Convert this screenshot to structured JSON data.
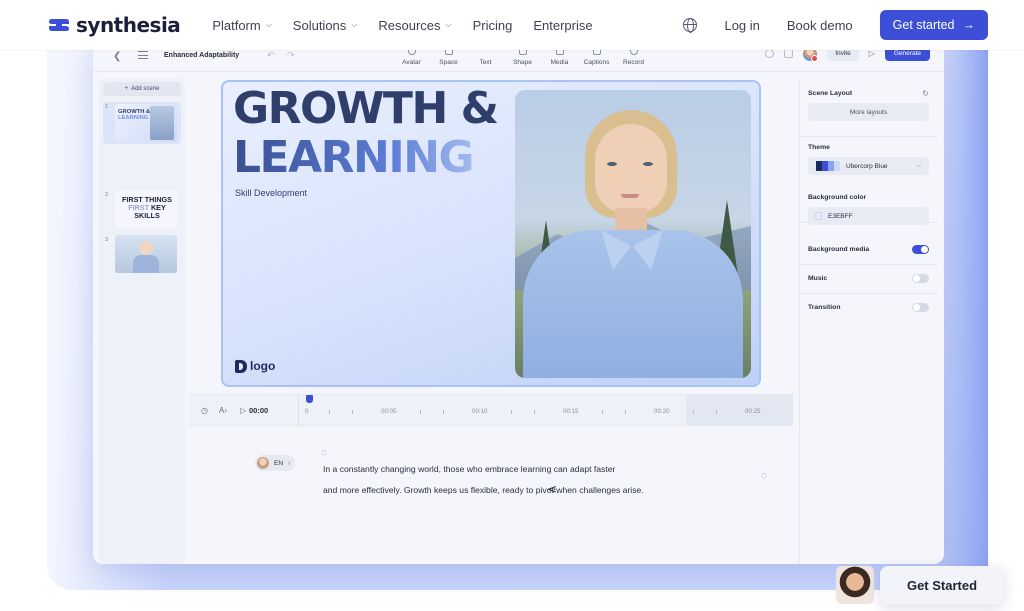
{
  "site": {
    "brand": "synthesia",
    "nav": [
      {
        "label": "Platform",
        "has_menu": true
      },
      {
        "label": "Solutions",
        "has_menu": true
      },
      {
        "label": "Resources",
        "has_menu": true
      },
      {
        "label": "Pricing",
        "has_menu": false
      },
      {
        "label": "Enterprise",
        "has_menu": false
      }
    ],
    "login": "Log in",
    "demo": "Book demo",
    "cta": "Get started",
    "cta_arrow": "→",
    "accent": "#3d4fd6"
  },
  "editor": {
    "project_title": "Enhanced Adaptability",
    "tools": [
      "Avatar",
      "Space",
      "Text",
      "Shape",
      "Media",
      "Captions",
      "Record"
    ],
    "invite": "Invite",
    "generate": "Generate",
    "add_scene": "Add scene",
    "scenes": [
      {
        "num": "1",
        "title_a": "GROWTH &",
        "title_b": "LEARNING"
      },
      {
        "num": "2",
        "line1": "FIRST THINGS",
        "line2a": "FIRST",
        "line2b": "KEY",
        "line3": "SKILLS"
      },
      {
        "num": "3"
      }
    ],
    "canvas": {
      "title_line1": "GROWTH &",
      "title_line2": "LEARNING",
      "subtitle": "Skill Development",
      "logo": "logo"
    },
    "properties": {
      "scene_layout": "Scene Layout",
      "more_layouts": "More layouts",
      "theme_label": "Theme",
      "theme_value": "Ubercorp Blue",
      "theme_swatches": [
        "#1b2b5b",
        "#3d4fd6",
        "#8aa2f2",
        "#cdd9f6"
      ],
      "bg_color_label": "Background color",
      "bg_color_value": "E3EBFF",
      "bg_color_hex": "#E3EBFF",
      "bg_media_label": "Background media",
      "bg_media_on": true,
      "music_label": "Music",
      "music_on": false,
      "transition_label": "Transition",
      "transition_on": false
    },
    "timeline": {
      "current": "00:00",
      "ticks": [
        "0",
        "00:05",
        "00:10",
        "00:15",
        "00:20",
        "00:25"
      ]
    },
    "script": {
      "language": "EN",
      "line1": "In a constantly changing world, those who embrace learning can adapt faster",
      "line2": "and more effectively. Growth keeps us flexible, ready to pivot when challenges arise."
    }
  },
  "chat": {
    "label": "Get Started"
  }
}
